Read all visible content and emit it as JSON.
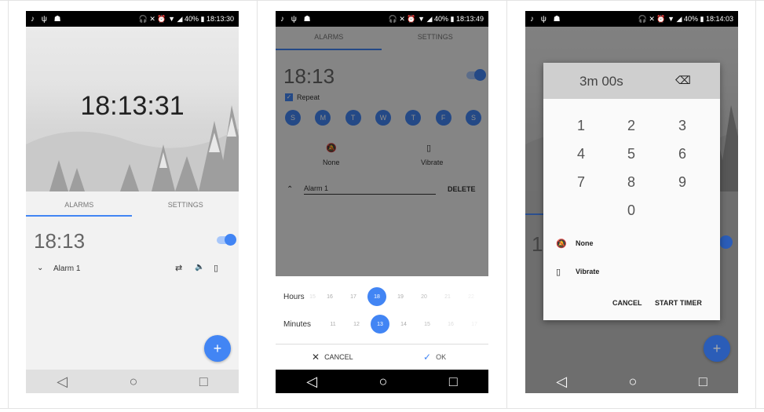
{
  "screen1": {
    "status_time": "18:13:30",
    "status_battery": "40%",
    "clock": "18:13:31",
    "tabs": [
      "ALARMS",
      "SETTINGS"
    ],
    "alarm_time": "18:13",
    "alarm_name": "Alarm 1",
    "fab_label": "+"
  },
  "screen2": {
    "status_time": "18:13:49",
    "status_battery": "40%",
    "tabs": [
      "ALARMS",
      "SETTINGS"
    ],
    "alarm_time": "18:13",
    "repeat_label": "Repeat",
    "days": [
      "S",
      "M",
      "T",
      "W",
      "T",
      "F",
      "S"
    ],
    "ringtone_label": "None",
    "vibrate_label": "Vibrate",
    "alarm_name": "Alarm 1",
    "delete_label": "DELETE",
    "hours_label": "Hours",
    "hours_values": [
      "15",
      "16",
      "17",
      "18",
      "19",
      "20",
      "21",
      "22"
    ],
    "minutes_label": "Minutes",
    "minutes_values": [
      "11",
      "12",
      "13",
      "14",
      "15",
      "16",
      "17"
    ],
    "cancel_label": "CANCEL",
    "ok_label": "OK"
  },
  "screen3": {
    "status_time": "18:14:03",
    "status_battery": "40%",
    "timer_display": "3m 00s",
    "keys": [
      "1",
      "2",
      "3",
      "4",
      "5",
      "6",
      "7",
      "8",
      "9",
      "0"
    ],
    "ringtone_label": "None",
    "vibrate_label": "Vibrate",
    "cancel_label": "CANCEL",
    "start_label": "START TIMER",
    "fab_label": "+",
    "bg_alarm_time_partial": "1"
  },
  "colors": {
    "accent": "#4285f4",
    "statusbar": "#000000",
    "navbar": "#e0e0e0"
  }
}
